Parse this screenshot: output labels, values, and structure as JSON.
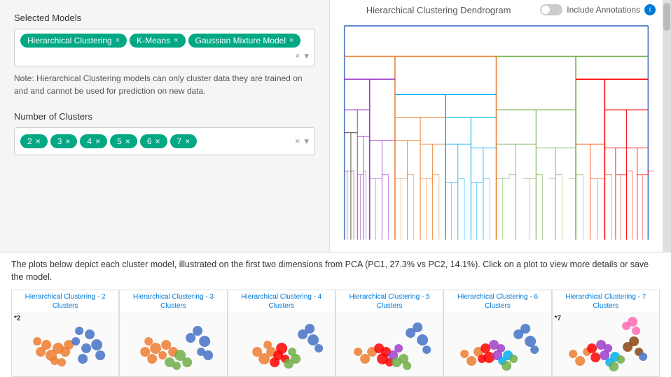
{
  "left": {
    "selected_models_label": "Selected Models",
    "models": [
      {
        "label": "Hierarchical Clustering",
        "id": "hc"
      },
      {
        "label": "K-Means",
        "id": "km"
      },
      {
        "label": "Gaussian Mixture Model",
        "id": "gmm"
      }
    ],
    "note": "Note: Hierarchical Clustering models can only cluster data they are trained on and and cannot be used for prediction on new data.",
    "clusters_label": "Number of Clusters",
    "cluster_numbers": [
      "2",
      "3",
      "4",
      "5",
      "6",
      "7"
    ]
  },
  "right": {
    "title": "Hierarchical Clustering Dendrogram",
    "toggle_label": "Include Annotations"
  },
  "bottom": {
    "description": "The plots below depict each cluster model, illustrated on the first two dimensions from PCA (PC1, 27.3% vs PC2, 14.1%). Click on a plot to view more details or save the model.",
    "plots": [
      {
        "title": "Hierarchical Clustering - 2 Clusters",
        "label": "*2"
      },
      {
        "title": "Hierarchical Clustering - 3 Clusters",
        "label": ""
      },
      {
        "title": "Hierarchical Clustering - 4 Clusters",
        "label": ""
      },
      {
        "title": "Hierarchical Clustering - 5 Clusters",
        "label": ""
      },
      {
        "title": "Hierarchical Clustering - 6 Clusters",
        "label": ""
      },
      {
        "title": "Hierarchical Clustering - 7 Clusters",
        "label": "*7"
      }
    ]
  }
}
